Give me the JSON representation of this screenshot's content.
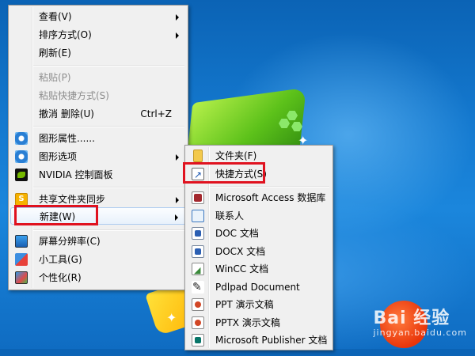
{
  "context_menu": {
    "items": [
      {
        "label": "查看(V)",
        "submenu": true
      },
      {
        "label": "排序方式(O)",
        "submenu": true
      },
      {
        "label": "刷新(E)"
      },
      {
        "label": "粘贴(P)",
        "disabled": true
      },
      {
        "label": "粘贴快捷方式(S)",
        "disabled": true
      },
      {
        "label": "撤消 删除(U)",
        "shortcut": "Ctrl+Z"
      },
      {
        "label": "图形属性......",
        "icon": "graphics-icon"
      },
      {
        "label": "图形选项",
        "icon": "graphics-icon",
        "submenu": true
      },
      {
        "label": "NVIDIA 控制面板",
        "icon": "nvidia-icon"
      },
      {
        "label": "共享文件夹同步",
        "icon": "share-sync-icon",
        "submenu": true
      },
      {
        "label": "新建(W)",
        "submenu": true,
        "highlighted": true
      },
      {
        "label": "屏幕分辨率(C)",
        "icon": "display-icon"
      },
      {
        "label": "小工具(G)",
        "icon": "gadgets-icon"
      },
      {
        "label": "个性化(R)",
        "icon": "personalize-icon"
      }
    ]
  },
  "new_submenu": {
    "items": [
      {
        "label": "文件夹(F)",
        "icon": "folder-icon"
      },
      {
        "label": "快捷方式(S)",
        "icon": "shortcut-icon"
      },
      {
        "label": "Microsoft Access 数据库",
        "icon": "access-icon"
      },
      {
        "label": "联系人",
        "icon": "contact-icon"
      },
      {
        "label": "DOC 文档",
        "icon": "doc-icon"
      },
      {
        "label": "DOCX 文档",
        "icon": "docx-icon"
      },
      {
        "label": "WinCC 文档",
        "icon": "wincc-icon"
      },
      {
        "label": "Pdlpad Document",
        "icon": "pdlpad-icon"
      },
      {
        "label": "PPT 演示文稿",
        "icon": "ppt-icon"
      },
      {
        "label": "PPTX 演示文稿",
        "icon": "pptx-icon"
      },
      {
        "label": "Microsoft Publisher 文档",
        "icon": "publisher-icon"
      }
    ]
  },
  "watermark": {
    "brand": "Bai 经验",
    "url": "jingyan.baidu.com"
  },
  "colors": {
    "highlight_box": "#e0121f",
    "menu_bg": "#f0f0f0"
  }
}
